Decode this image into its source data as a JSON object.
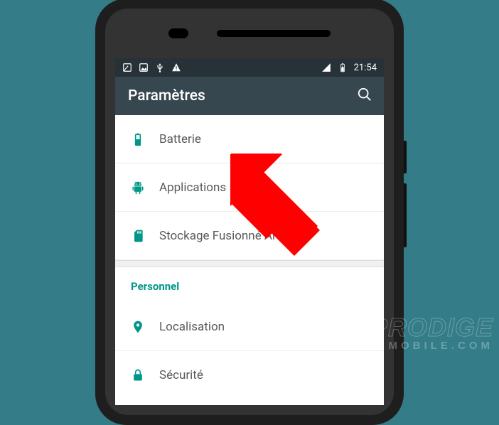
{
  "statusbar": {
    "time": "21:54"
  },
  "appbar": {
    "title": "Paramètres"
  },
  "settings": {
    "items": [
      {
        "id": "battery",
        "label": "Batterie"
      },
      {
        "id": "applications",
        "label": "Applications"
      },
      {
        "id": "storage",
        "label": "Stockage Fusionné Archos"
      }
    ],
    "section_personal": "Personnel",
    "personal_items": [
      {
        "id": "location",
        "label": "Localisation"
      },
      {
        "id": "security",
        "label": "Sécurité"
      }
    ]
  },
  "watermark": {
    "line1": "PRODIGE",
    "line2": "MOBILE.COM"
  }
}
